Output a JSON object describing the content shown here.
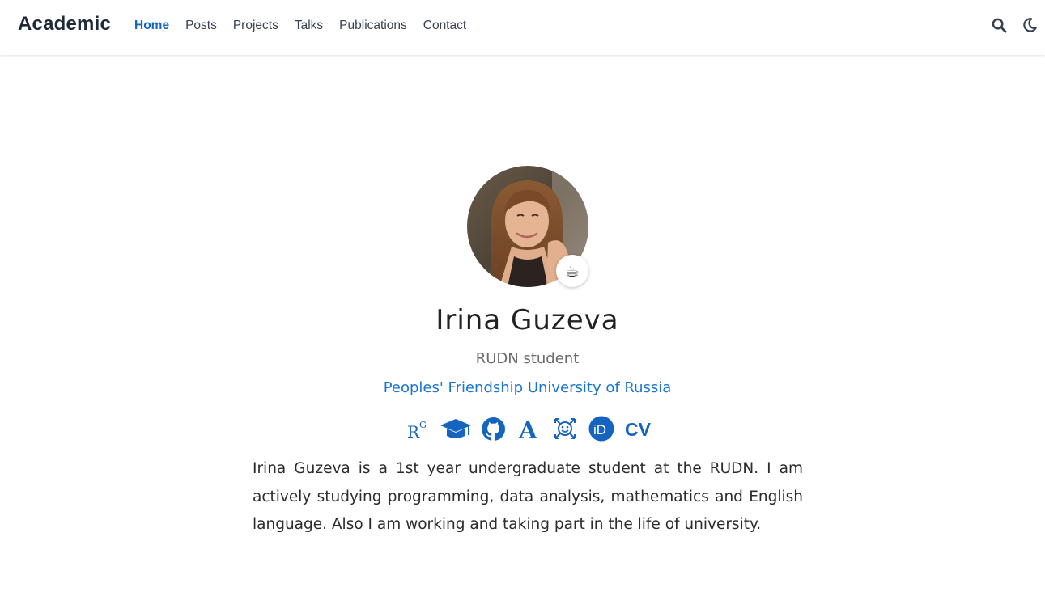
{
  "brand": "Academic",
  "nav": {
    "items": [
      {
        "label": "Home",
        "active": true
      },
      {
        "label": "Posts",
        "active": false
      },
      {
        "label": "Projects",
        "active": false
      },
      {
        "label": "Talks",
        "active": false
      },
      {
        "label": "Publications",
        "active": false
      },
      {
        "label": "Contact",
        "active": false
      }
    ],
    "icons": [
      "search-icon",
      "moon-icon"
    ]
  },
  "profile": {
    "status_emoji": "☕",
    "name": "Irina Guzeva",
    "role": "RUDN student",
    "organization": "Peoples' Friendship University of Russia",
    "social_icons": [
      "researchgate-icon",
      "graduation-cap-icon",
      "github-icon",
      "academia-icon",
      "mathnet-icon",
      "orcid-icon",
      "cv-icon"
    ],
    "cv_label": "CV",
    "researchgate_label": "R",
    "researchgate_sup": "G",
    "academia_label": "A",
    "orcid_label": "iD",
    "bio": "Irina Guzeva is a 1st year undergraduate student at the RUDN. I am actively studying programming, data analysis, mathematics and English language. Also I am working and taking part in the life of university."
  },
  "colors": {
    "accent": "#1565c0",
    "link": "#1976d2",
    "text": "#2b2b2b",
    "muted": "#6b6b6b"
  }
}
